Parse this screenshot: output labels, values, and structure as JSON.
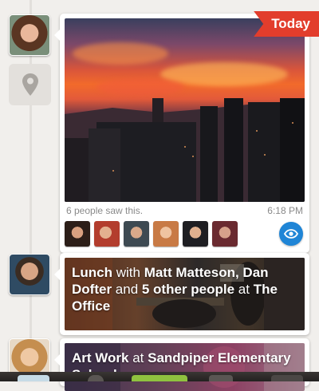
{
  "moment1": {
    "banner": "Today",
    "views_text": "6 people saw this.",
    "time": "6:18 PM",
    "icon": "location-pin-icon"
  },
  "moment2": {
    "t1": "Lunch",
    "t2": " with ",
    "t3": "Matt Matteson, Dan Dofter",
    "t4": " and ",
    "t5": "5 other people",
    "t6": " at ",
    "t7": "The Office"
  },
  "moment3": {
    "t1": "Art Work",
    "t2": " at ",
    "t3": "Sandpiper Elementary School"
  },
  "colors": {
    "accent_red": "#e23d2c",
    "eye_blue": "#1f85d6",
    "tab_green": "#8fc23f"
  }
}
